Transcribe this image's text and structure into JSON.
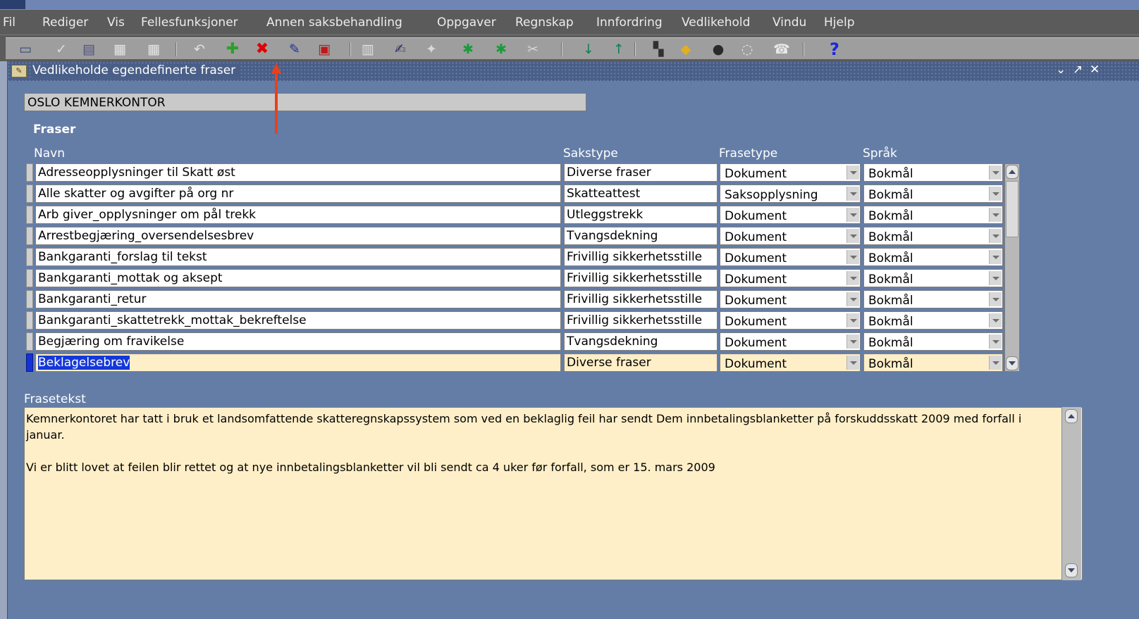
{
  "menu": [
    "Fil",
    "Rediger",
    "Vis",
    "Fellesfunksjoner",
    "Annen saksbehandling",
    "Oppgaver",
    "Regnskap",
    "Innfordring",
    "Vedlikehold",
    "Vindu",
    "Hjelp"
  ],
  "toolbar": {
    "icons": [
      "save-icon",
      "check-icon",
      "print-icon",
      "page-icon",
      "page-settings-icon",
      "undo-icon",
      "new-record-icon",
      "delete-record-icon",
      "clear-record-icon",
      "cancel-query-icon",
      "query-icon",
      "edit-icon",
      "wand-icon",
      "help-key-icon",
      "find-icon",
      "tools-icon",
      "arrow-down-icon",
      "arrow-up-icon",
      "network-icon",
      "attach-icon",
      "folder-icon",
      "comment-icon",
      "phone-icon",
      "question-icon"
    ],
    "accent_new": "#2ca02c",
    "accent_delete": "#e00000",
    "accent_help": "#1a2ad8"
  },
  "window": {
    "title": "Vedlikeholde egendefinerte fraser"
  },
  "office": "OSLO KEMNERKONTOR",
  "section": "Fraser",
  "columns": {
    "navn": "Navn",
    "sakstype": "Sakstype",
    "frasetype": "Frasetype",
    "sprak": "Språk"
  },
  "rows": [
    {
      "navn": "Adresseopplysninger til Skatt øst",
      "sakstype": "Diverse fraser",
      "frasetype": "Dokument",
      "sprak": "Bokmål"
    },
    {
      "navn": "Alle skatter og avgifter på org nr",
      "sakstype": "Skatteattest",
      "frasetype": "Saksopplysning",
      "sprak": "Bokmål"
    },
    {
      "navn": "Arb giver_opplysninger om pål trekk",
      "sakstype": "Utleggstrekk",
      "frasetype": "Dokument",
      "sprak": "Bokmål"
    },
    {
      "navn": "Arrestbegjæring_oversendelsesbrev",
      "sakstype": "Tvangsdekning",
      "frasetype": "Dokument",
      "sprak": "Bokmål"
    },
    {
      "navn": "Bankgaranti_forslag til tekst",
      "sakstype": "Frivillig sikkerhetsstille",
      "frasetype": "Dokument",
      "sprak": "Bokmål"
    },
    {
      "navn": "Bankgaranti_mottak og aksept",
      "sakstype": "Frivillig sikkerhetsstille",
      "frasetype": "Dokument",
      "sprak": "Bokmål"
    },
    {
      "navn": "Bankgaranti_retur",
      "sakstype": "Frivillig sikkerhetsstille",
      "frasetype": "Dokument",
      "sprak": "Bokmål"
    },
    {
      "navn": "Bankgaranti_skattetrekk_mottak_bekreftelse",
      "sakstype": "Frivillig sikkerhetsstille",
      "frasetype": "Dokument",
      "sprak": "Bokmål"
    },
    {
      "navn": "Begjæring om fravikelse",
      "sakstype": "Tvangsdekning",
      "frasetype": "Dokument",
      "sprak": "Bokmål"
    },
    {
      "navn": "Beklagelsebrev",
      "sakstype": "Diverse fraser",
      "frasetype": "Dokument",
      "sprak": "Bokmål",
      "current": true
    }
  ],
  "frasetekst": {
    "label": "Frasetekst",
    "paragraphs": [
      "Kemnerkontoret har tatt i bruk et landsomfattende skatteregnskapssystem som ved en beklaglig feil har sendt Dem innbetalingsblanketter på forskuddsskatt 2009 med forfall i januar.",
      "Vi er blitt lovet at feilen blir rettet og at nye innbetalingsblanketter vil bli sendt ca 4 uker før forfall, som er 15. mars 2009"
    ]
  },
  "colors": {
    "workspace": "#647da6",
    "current_row": "#ffefc8",
    "selection": "#1438d8",
    "annotation_arrow": "#e8401c"
  }
}
